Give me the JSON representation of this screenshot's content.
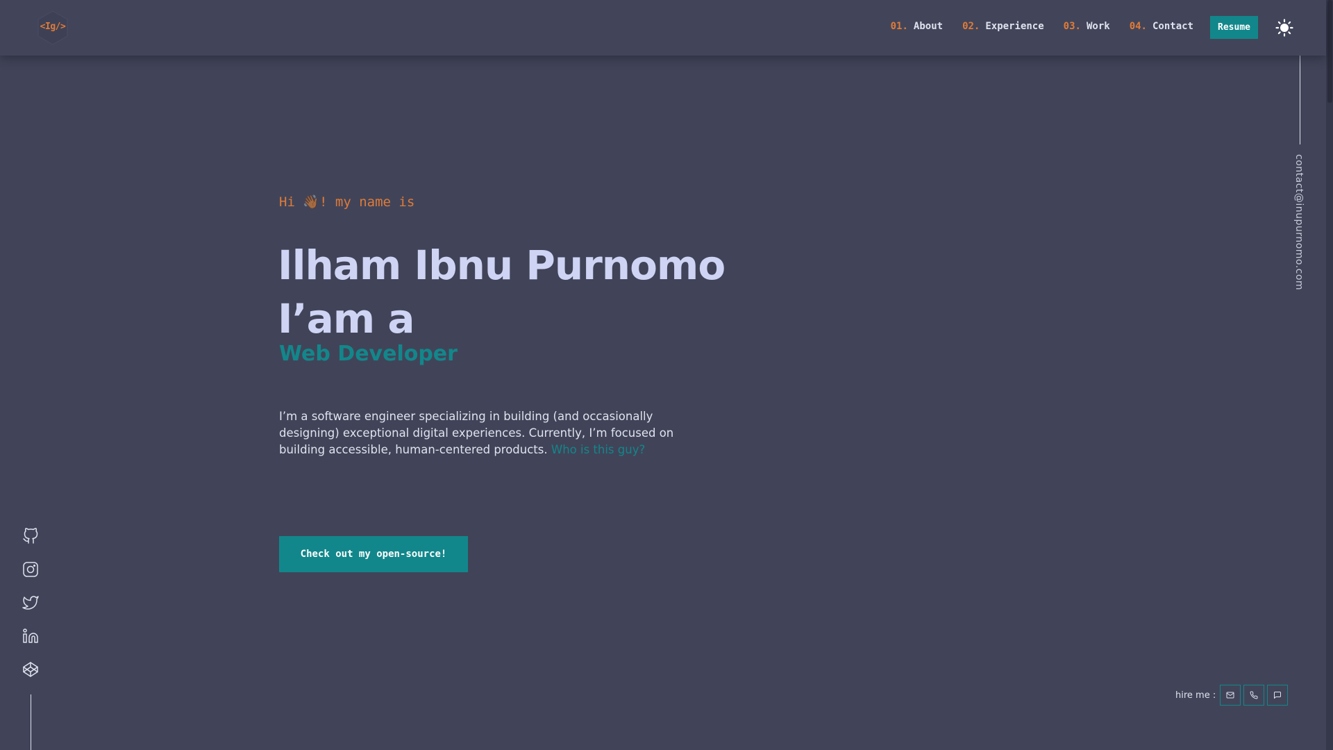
{
  "header": {
    "logo_text": "<Ig/>",
    "nav": [
      {
        "num": "01.",
        "label": "About"
      },
      {
        "num": "02.",
        "label": "Experience"
      },
      {
        "num": "03.",
        "label": "Work"
      },
      {
        "num": "04.",
        "label": "Contact"
      }
    ],
    "resume_label": "Resume",
    "theme_icon": "sun-icon"
  },
  "sidebar_right": {
    "email": "contact@inupurnomo.com"
  },
  "social": [
    {
      "icon": "github-icon"
    },
    {
      "icon": "instagram-icon"
    },
    {
      "icon": "twitter-icon"
    },
    {
      "icon": "linkedin-icon"
    },
    {
      "icon": "codepen-icon"
    }
  ],
  "hero": {
    "greeting_before": "Hi ",
    "greeting_emoji": "👋🏾",
    "greeting_after": "! my name is",
    "name": "Ilham Ibnu Purnomo",
    "iam": "I’am a",
    "role": "Web Developer",
    "bio_text": "I’m a software engineer specializing in building (and occasionally designing) exceptional digital experiences. Currently, I’m focused on building accessible, human-centered products. ",
    "bio_link": "Who is this guy?",
    "cta_label": "Check out my open-source!"
  },
  "hire": {
    "label": "hire me :",
    "buttons": [
      {
        "icon": "mail-icon"
      },
      {
        "icon": "phone-icon"
      },
      {
        "icon": "chat-icon"
      }
    ]
  },
  "colors": {
    "background": "#414458",
    "accent": "#12878b",
    "orange": "#e07b39",
    "heading": "#cfd4f4"
  }
}
